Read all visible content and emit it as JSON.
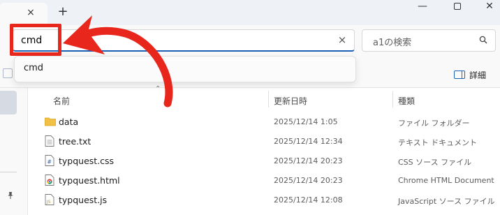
{
  "window": {
    "tab_close": "×",
    "tab_new": "+",
    "min_label": "—",
    "close_label": "✕"
  },
  "address": {
    "value": "cmd",
    "clear": "×"
  },
  "search": {
    "placeholder": "a1の検索"
  },
  "toolbar": {
    "details_label": "詳細"
  },
  "dropdown": {
    "suggestion": "cmd"
  },
  "columns": {
    "name": "名前",
    "date": "更新日時",
    "type": "種類"
  },
  "files": [
    {
      "name": "data",
      "date": "2025/12/14 1:05",
      "type": "ファイル フォルダー",
      "icon": "folder-icon"
    },
    {
      "name": "tree.txt",
      "date": "2025/12/14 12:34",
      "type": "テキスト ドキュメント",
      "icon": "text-file-icon"
    },
    {
      "name": "typquest.css",
      "date": "2025/12/14 20:23",
      "type": "CSS ソース ファイル",
      "icon": "css-file-icon"
    },
    {
      "name": "typquest.html",
      "date": "2025/12/14 20:23",
      "type": "Chrome HTML Document",
      "icon": "chrome-html-icon"
    },
    {
      "name": "typquest.js",
      "date": "2025/12/14 12:08",
      "type": "JavaScript ソース ファイル",
      "icon": "js-file-icon"
    }
  ],
  "annotation": {
    "color": "#e8261c"
  },
  "colors": {
    "accent": "#1a5fb4",
    "folder": "#f2c044"
  }
}
